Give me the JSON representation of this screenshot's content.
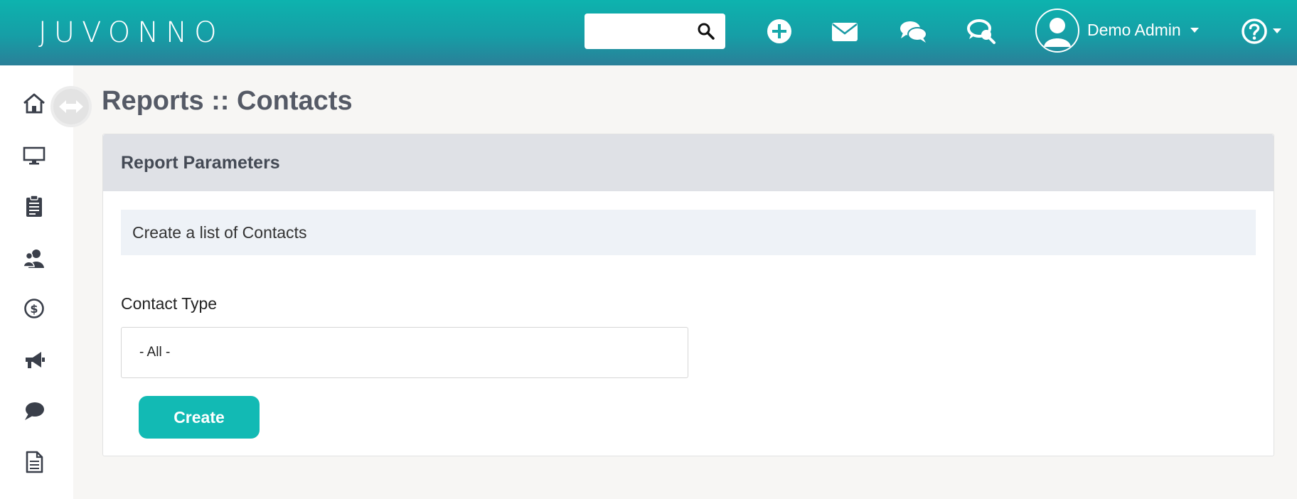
{
  "header": {
    "logo_text": "JUVONNO",
    "search": {
      "value": "",
      "placeholder": ""
    },
    "user_name": "Demo Admin"
  },
  "icons": {
    "header": [
      "search-icon",
      "plus-circle-icon",
      "envelope-icon",
      "chat-bubbles-icon",
      "chat-search-icon",
      "user-avatar-icon",
      "caret-down-icon",
      "help-circle-icon"
    ],
    "sidebar": [
      "home-icon",
      "monitor-icon",
      "clipboard-icon",
      "contacts-icon",
      "dollar-circle-icon",
      "megaphone-icon",
      "chat-bubble-icon",
      "document-icon"
    ]
  },
  "colors": {
    "header_top": "#0db3ae",
    "header_bottom": "#2a7f98",
    "accent": "#12bab4",
    "panel_header_bg": "#dfe1e6",
    "info_bg": "#eef2f7",
    "sidebar_icon": "#3a3f4a"
  },
  "page": {
    "title": "Reports :: Contacts"
  },
  "panel": {
    "title": "Report Parameters",
    "info": "Create a list of Contacts",
    "field_label": "Contact Type",
    "select_value": "- All -",
    "create_label": "Create"
  }
}
